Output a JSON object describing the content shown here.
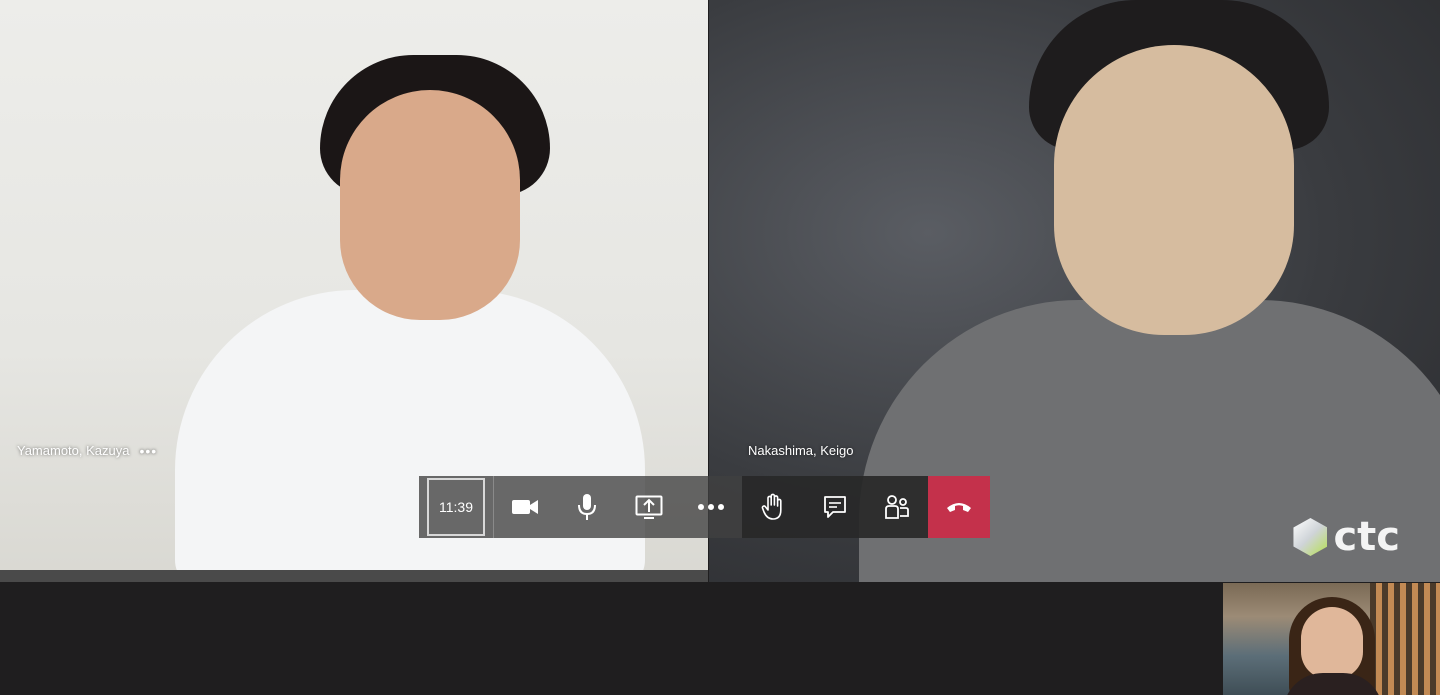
{
  "participants": [
    {
      "name": "Yamamoto, Kazuya",
      "menu_glyph": "•••"
    },
    {
      "name": "Nakashima, Keigo"
    }
  ],
  "call_bar": {
    "timer": "11:39",
    "buttons": [
      {
        "id": "camera",
        "icon": "video-camera-icon"
      },
      {
        "id": "mic",
        "icon": "microphone-icon"
      },
      {
        "id": "share",
        "icon": "share-screen-icon"
      },
      {
        "id": "more",
        "icon": "more-options-icon"
      },
      {
        "id": "raise-hand",
        "icon": "raise-hand-icon"
      },
      {
        "id": "chat",
        "icon": "chat-icon"
      },
      {
        "id": "participants",
        "icon": "people-icon"
      },
      {
        "id": "hangup",
        "icon": "hang-up-icon"
      }
    ],
    "hangup_color": "#c4314b"
  },
  "video_logo": {
    "text": "ctc"
  }
}
